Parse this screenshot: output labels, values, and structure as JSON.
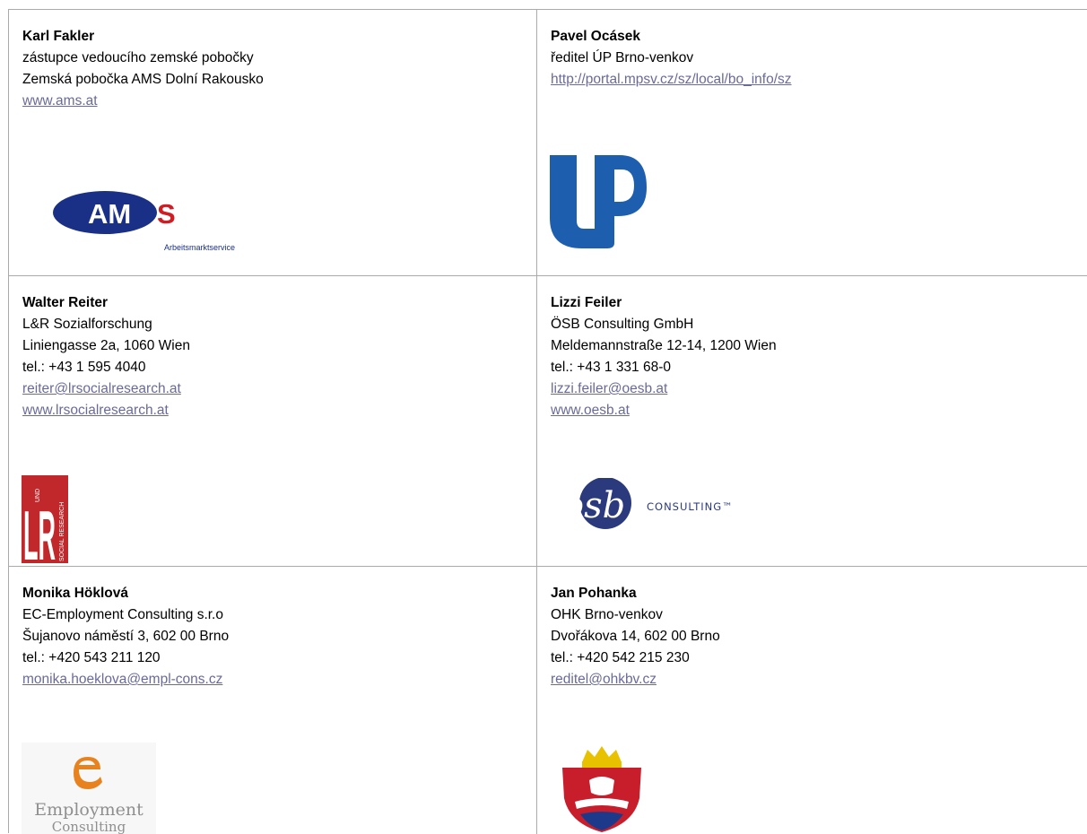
{
  "contacts": [
    {
      "name": "Karl Fakler",
      "lines": [
        "zástupce vedoucího zemské pobočky",
        "Zemská pobočka AMS Dolní Rakousko"
      ],
      "links": [
        "www.ams.at"
      ],
      "logo": {
        "text": "AMS",
        "subtext": "Arbeitsmarktservice"
      }
    },
    {
      "name": "Pavel Ocásek",
      "lines": [
        "ředitel ÚP Brno-venkov"
      ],
      "links": [
        "http://portal.mpsv.cz/sz/local/bo_info/sz"
      ],
      "logo": {
        "text": ""
      }
    },
    {
      "name": "Walter Reiter",
      "lines": [
        "L&R Sozialforschung",
        "Liniengasse 2a, 1060 Wien",
        "tel.: +43 1 595 4040"
      ],
      "links": [
        "reiter@lrsocialresearch.at",
        "www.lrsocialresearch.at"
      ],
      "logo": {
        "text": "LR",
        "und": "UND",
        "side": "SOCIAL RESEARCH"
      }
    },
    {
      "name": "Lizzi Feiler",
      "lines": [
        "ÖSB Consulting GmbH",
        "Meldemannstraße 12-14, 1200 Wien",
        "tel.: +43 1 331 68-0"
      ],
      "links": [
        "lizzi.feiler@oesb.at",
        "www.oesb.at"
      ],
      "logo": {
        "text": "ösb",
        "subtext": "CONSULTING™"
      }
    },
    {
      "name": "Monika Höklová",
      "lines": [
        "EC-Employment Consulting s.r.o",
        "Šujanovo náměstí 3, 602 00 Brno",
        "tel.: +420 543 211 120"
      ],
      "links": [
        "monika.hoeklova@empl-cons.cz"
      ],
      "logo": {
        "text": "Employment",
        "subtext": "Consulting"
      }
    },
    {
      "name": "Jan Pohanka",
      "lines": [
        "OHK Brno-venkov",
        "Dvořákova 14, 602 00 Brno",
        "tel.: +420 542 215 230"
      ],
      "links": [
        "reditel@ohkbv.cz"
      ],
      "logo": {
        "text": ""
      }
    }
  ],
  "colors": {
    "ams_blue": "#1a2f86",
    "ams_red": "#d01d24",
    "up_blue": "#1d5fae",
    "lr_red": "#c0282c",
    "osb_blue": "#2b3a7c",
    "ec_orange": "#e8821e"
  }
}
